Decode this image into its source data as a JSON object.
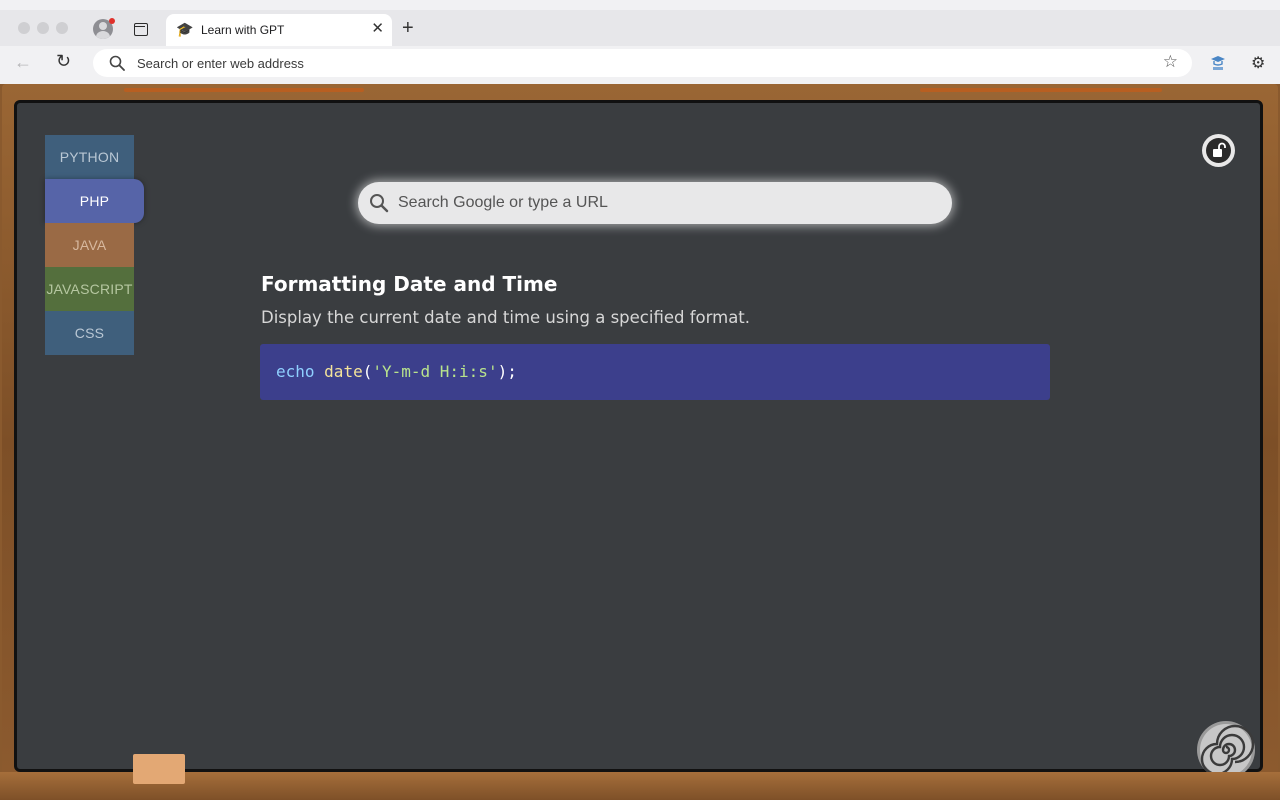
{
  "browser": {
    "tab_title": "Learn with GPT",
    "tab_icon": "graduation-cap-icon",
    "address_placeholder": "Search or enter web address",
    "icons": [
      "back-arrow-icon",
      "reload-icon",
      "search-icon",
      "star-icon",
      "gpt-extension-icon",
      "puzzle-icon",
      "close-icon",
      "plus-icon",
      "sidebar-icon",
      "profile-icon"
    ]
  },
  "languages": [
    {
      "label": "PYTHON",
      "active": false
    },
    {
      "label": "PHP",
      "active": true
    },
    {
      "label": "JAVA",
      "active": false
    },
    {
      "label": "JAVASCRIPT",
      "active": false
    },
    {
      "label": "CSS",
      "active": false
    }
  ],
  "search": {
    "placeholder": "Search Google or type a URL"
  },
  "snippet": {
    "title": "Formatting Date and Time",
    "description": "Display the current date and time using a specified format.",
    "code": {
      "keyword": "echo",
      "function": "date",
      "open": "(",
      "string": "'Y-m-d H:i:s'",
      "close": ");"
    }
  },
  "colors": {
    "board": "#3a3d40",
    "code_bg": "#3c3f8c",
    "php_tab": "#5664a8",
    "frame": "#8a5a2e"
  },
  "page_icons": [
    "lock-icon",
    "spiral-logo-icon"
  ]
}
